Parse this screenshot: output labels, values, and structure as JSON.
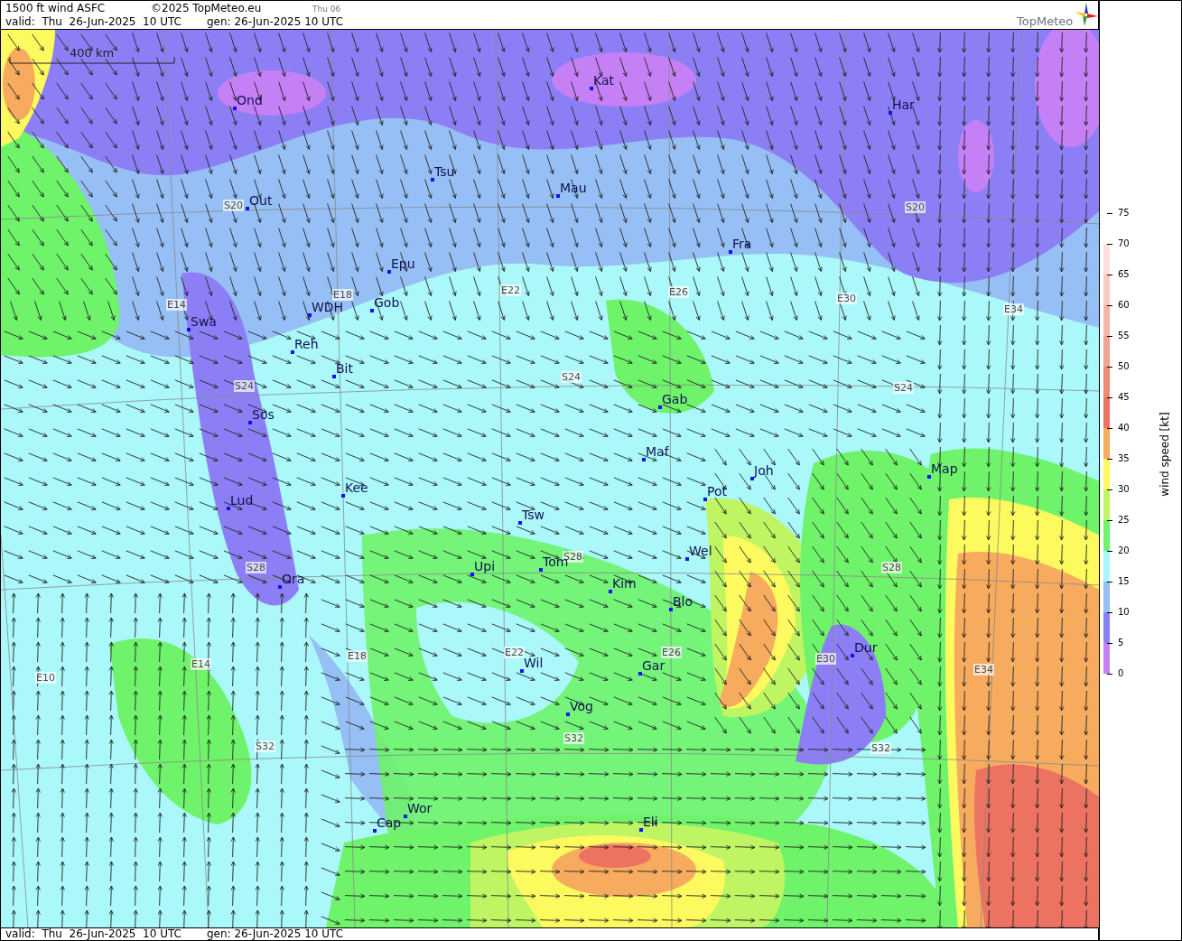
{
  "header": {
    "title": "1500 ft wind ASFC",
    "copyright": "©2025 TopMeteo.eu",
    "day_label": "Thu 06",
    "valid": "valid:  Thu  26-Jun-2025  10 UTC",
    "gen": "gen: 26-Jun-2025 10 UTC",
    "logo_text": "TopMeteo"
  },
  "map": {
    "scale_label": "400 km",
    "cities": [
      {
        "name": "Ond"
      },
      {
        "name": "Kat"
      },
      {
        "name": "Har"
      },
      {
        "name": "Tsu"
      },
      {
        "name": "Mau"
      },
      {
        "name": "Out"
      },
      {
        "name": "Fra"
      },
      {
        "name": "Epu"
      },
      {
        "name": "WDH"
      },
      {
        "name": "Gob"
      },
      {
        "name": "Swa"
      },
      {
        "name": "Reh"
      },
      {
        "name": "Bit"
      },
      {
        "name": "Gab"
      },
      {
        "name": "Sos"
      },
      {
        "name": "Maf"
      },
      {
        "name": "Joh"
      },
      {
        "name": "Map"
      },
      {
        "name": "Kee"
      },
      {
        "name": "Pot"
      },
      {
        "name": "Lud"
      },
      {
        "name": "Tsw"
      },
      {
        "name": "Wel"
      },
      {
        "name": "Tom"
      },
      {
        "name": "Upi"
      },
      {
        "name": "Kim"
      },
      {
        "name": "Ora"
      },
      {
        "name": "Blo"
      },
      {
        "name": "Dur"
      },
      {
        "name": "Wil"
      },
      {
        "name": "Gar"
      },
      {
        "name": "Vog"
      },
      {
        "name": "Wor"
      },
      {
        "name": "Cap"
      },
      {
        "name": "Eli"
      }
    ],
    "grid_labels": [
      "S20",
      "S20",
      "E14",
      "E18",
      "E22",
      "E26",
      "E30",
      "E34",
      "S24",
      "S24",
      "S24",
      "S28",
      "S28",
      "S28",
      "E10",
      "E14",
      "E18",
      "E22",
      "E26",
      "E30",
      "E34",
      "S32",
      "S32",
      "S32"
    ]
  },
  "legend": {
    "title": "wind speed [kt]",
    "bands": [
      {
        "color": "#fbe0dc"
      },
      {
        "color": "#f8cbc3"
      },
      {
        "color": "#f4b4a8"
      },
      {
        "color": "#f2a394"
      },
      {
        "color": "#ef8b77"
      },
      {
        "color": "#ec7361"
      },
      {
        "color": "#f7ab5f"
      },
      {
        "color": "#fcfa5e"
      },
      {
        "color": "#bff563"
      },
      {
        "color": "#6ef36a"
      },
      {
        "color": "#aaf8fa"
      },
      {
        "color": "#96bff5"
      },
      {
        "color": "#8c7ff5"
      },
      {
        "color": "#c580f5"
      }
    ],
    "ticks": [
      "75",
      "70",
      "65",
      "60",
      "55",
      "50",
      "45",
      "40",
      "35",
      "30",
      "25",
      "20",
      "15",
      "10",
      "5",
      "0"
    ]
  },
  "footer": {
    "valid": "valid:  Thu  26-Jun-2025  10 UTC",
    "gen": "gen: 26-Jun-2025 10 UTC"
  }
}
